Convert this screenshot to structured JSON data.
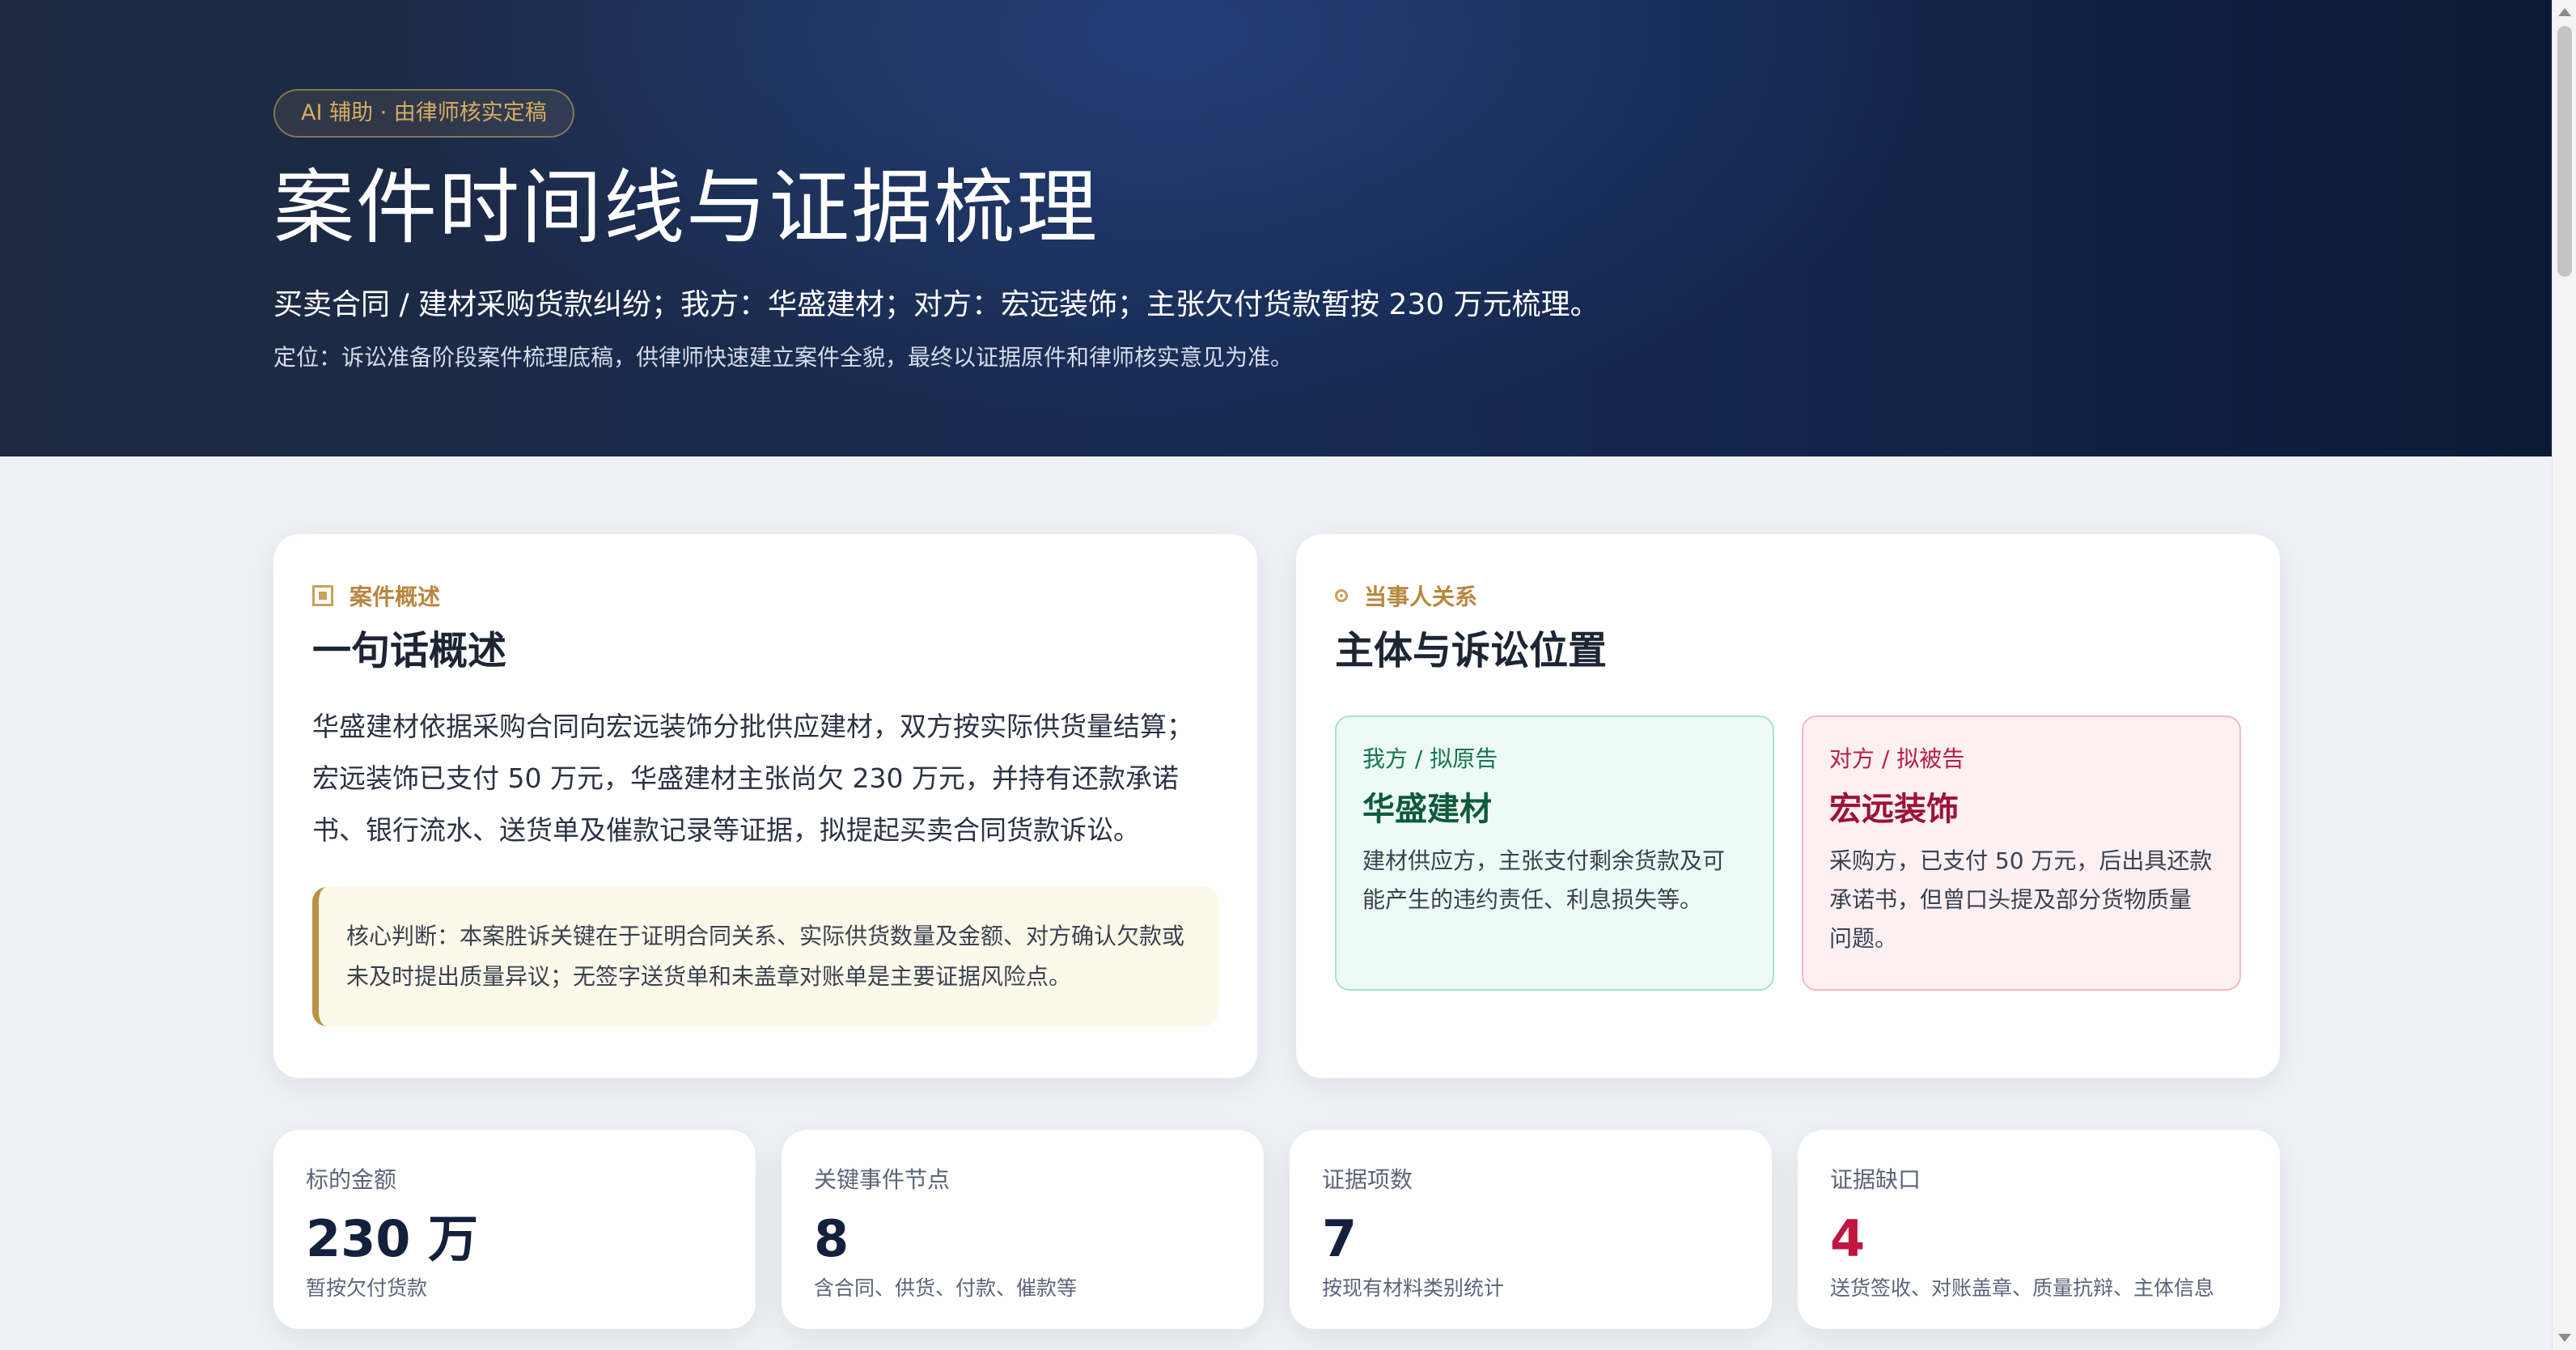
{
  "hero": {
    "badge": "AI 辅助 · 由律师核实定稿",
    "title": "案件时间线与证据梳理",
    "subtitle": "买卖合同 / 建材采购货款纠纷；我方：华盛建材；对方：宏远装饰；主张欠付货款暂按 230 万元梳理。",
    "note": "定位：诉讼准备阶段案件梳理底稿，供律师快速建立案件全貌，最终以证据原件和律师核实意见为准。"
  },
  "overview": {
    "eyebrow": "案件概述",
    "title": "一句话概述",
    "text": "华盛建材依据采购合同向宏远装饰分批供应建材，双方按实际供货量结算；宏远装饰已支付 50 万元，华盛建材主张尚欠 230 万元，并持有还款承诺书、银行流水、送货单及催款记录等证据，拟提起买卖合同货款诉讼。",
    "core": "核心判断：本案胜诉关键在于证明合同关系、实际供货数量及金额、对方确认欠款或未及时提出质量异议；无签字送货单和未盖章对账单是主要证据风险点。"
  },
  "parties": {
    "eyebrow": "当事人关系",
    "title": "主体与诉讼位置",
    "us": {
      "role": "我方 / 拟原告",
      "name": "华盛建材",
      "desc": "建材供应方，主张支付剩余货款及可能产生的违约责任、利息损失等。"
    },
    "them": {
      "role": "对方 / 拟被告",
      "name": "宏远装饰",
      "desc": "采购方，已支付 50 万元，后出具还款承诺书，但曾口头提及部分货物质量问题。"
    }
  },
  "stats": [
    {
      "label": "标的金额",
      "value": "230 万",
      "desc": "暂按欠付货款"
    },
    {
      "label": "关键事件节点",
      "value": "8",
      "desc": "含合同、供货、付款、催款等"
    },
    {
      "label": "证据项数",
      "value": "7",
      "desc": "按现有材料类别统计"
    },
    {
      "label": "证据缺口",
      "value": "4",
      "desc": "送货签收、对账盖章、质量抗辩、主体信息"
    }
  ]
}
